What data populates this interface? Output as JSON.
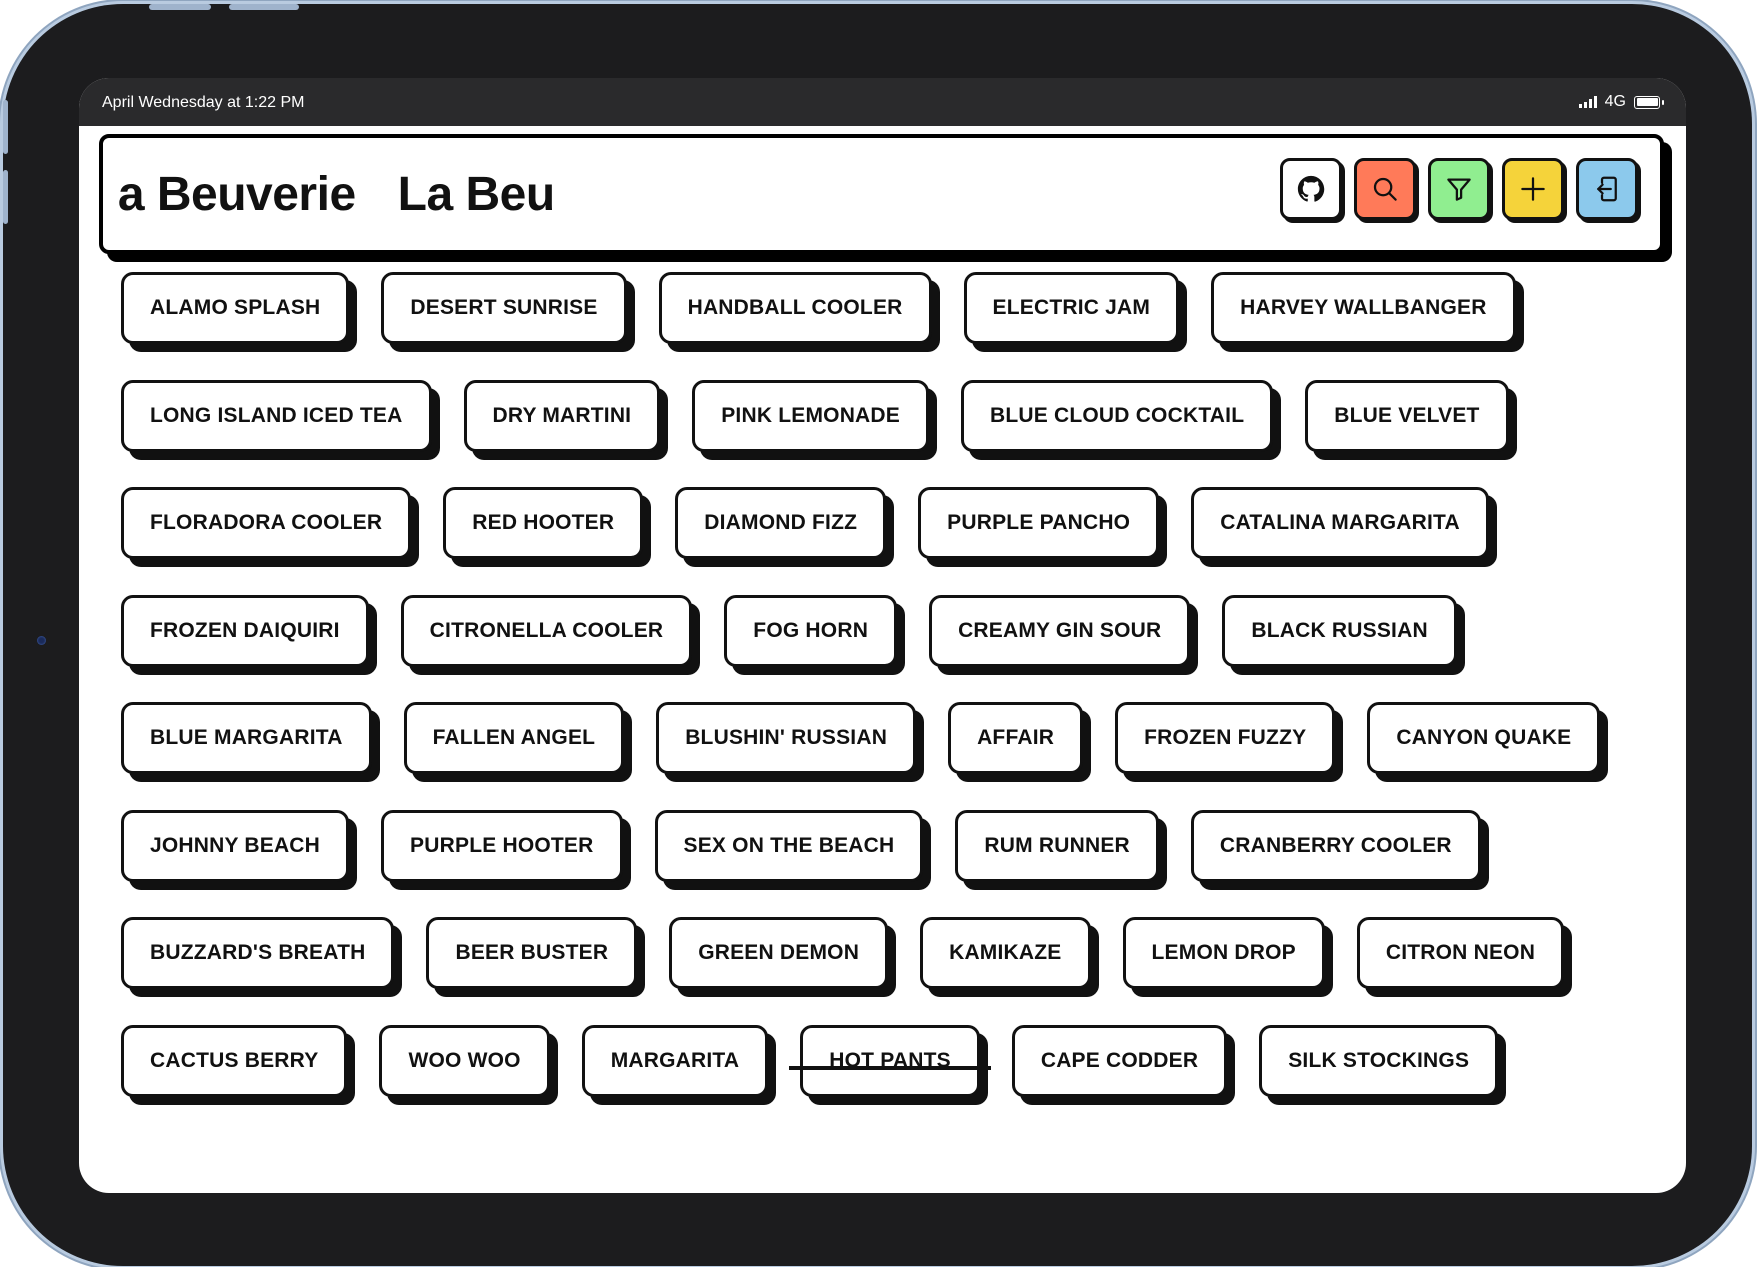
{
  "status_bar": {
    "time": "April Wednesday at 1:22 PM",
    "network": "4G"
  },
  "header": {
    "marquee_text": "La Beuverie",
    "buttons": [
      {
        "name": "github-button",
        "icon": "github-icon",
        "color": "#ffffff"
      },
      {
        "name": "search-button",
        "icon": "search-icon",
        "color": "#ff7a59"
      },
      {
        "name": "filter-button",
        "icon": "filter-icon",
        "color": "#90ee90"
      },
      {
        "name": "add-button",
        "icon": "plus-icon",
        "color": "#f5d33a"
      },
      {
        "name": "login-button",
        "icon": "login-icon",
        "color": "#8cc9ec"
      }
    ]
  },
  "cocktails": [
    [
      "ALAMO SPLASH",
      "DESERT SUNRISE",
      "HANDBALL COOLER",
      "ELECTRIC JAM",
      "HARVEY WALLBANGER"
    ],
    [
      "LONG ISLAND ICED TEA",
      "DRY MARTINI",
      "PINK LEMONADE",
      "BLUE CLOUD COCKTAIL",
      "BLUE VELVET"
    ],
    [
      "FLORADORA COOLER",
      "RED HOOTER",
      "DIAMOND FIZZ",
      "PURPLE PANCHO",
      "CATALINA MARGARITA"
    ],
    [
      "FROZEN DAIQUIRI",
      "CITRONELLA COOLER",
      "FOG HORN",
      "CREAMY GIN SOUR",
      "BLACK RUSSIAN"
    ],
    [
      "BLUE MARGARITA",
      "FALLEN ANGEL",
      "BLUSHIN' RUSSIAN",
      "AFFAIR",
      "FROZEN FUZZY",
      "CANYON QUAKE"
    ],
    [
      "JOHNNY BEACH",
      "PURPLE HOOTER",
      "SEX ON THE BEACH",
      "RUM RUNNER",
      "CRANBERRY COOLER"
    ],
    [
      "BUZZARD'S BREATH",
      "BEER BUSTER",
      "GREEN DEMON",
      "KAMIKAZE",
      "LEMON DROP",
      "CITRON NEON"
    ],
    [
      "CACTUS BERRY",
      "WOO WOO",
      "MARGARITA",
      "HOT PANTS",
      "CAPE CODDER",
      "SILK STOCKINGS"
    ]
  ]
}
